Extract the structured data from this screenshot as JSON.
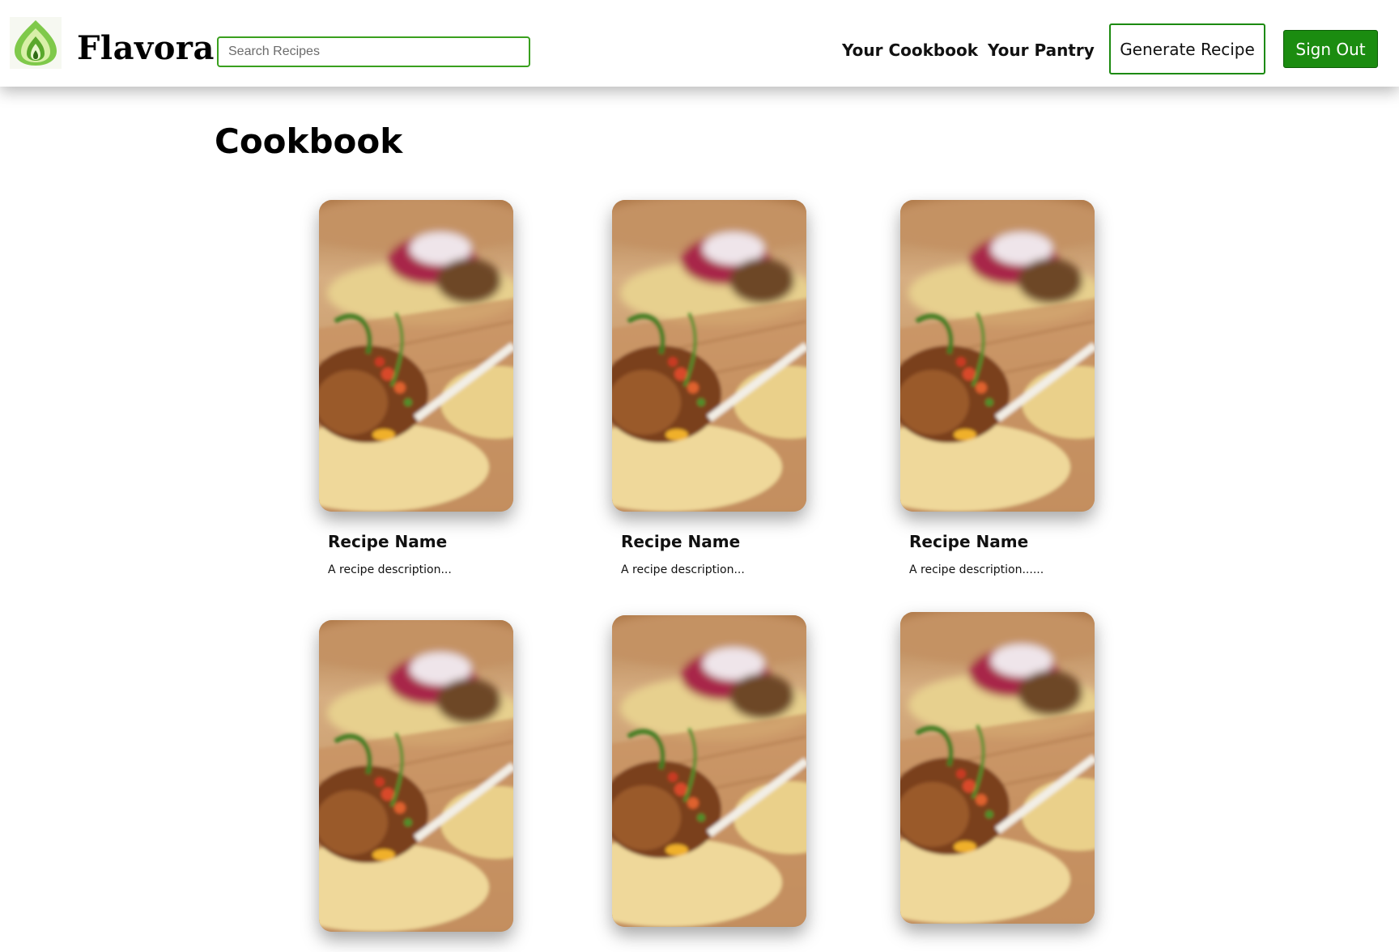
{
  "brand": {
    "name": "Flavora",
    "logo_icon": "flame-leaf-icon",
    "accent_color": "#1b8c10",
    "logo_colors": [
      "#7fc94a",
      "#d8f0a8",
      "#2f6b16"
    ]
  },
  "search": {
    "placeholder": "Search Recipes",
    "value": ""
  },
  "nav": {
    "links": [
      "Your Cookbook",
      "Your Pantry"
    ],
    "generate_label": "Generate Recipe",
    "signout_label": "Sign Out"
  },
  "page": {
    "title": "Cookbook"
  },
  "recipes": [
    {
      "name": "Recipe Name",
      "description": "A recipe description...",
      "image": "tacos-photo"
    },
    {
      "name": "Recipe Name",
      "description": "A recipe description...",
      "image": "tacos-photo"
    },
    {
      "name": "Recipe Name",
      "description": "A recipe description......",
      "image": "tacos-photo"
    },
    {
      "name": "",
      "description": "",
      "image": "tacos-photo"
    },
    {
      "name": "",
      "description": "",
      "image": "tacos-photo"
    },
    {
      "name": "",
      "description": "",
      "image": "tacos-photo"
    }
  ]
}
